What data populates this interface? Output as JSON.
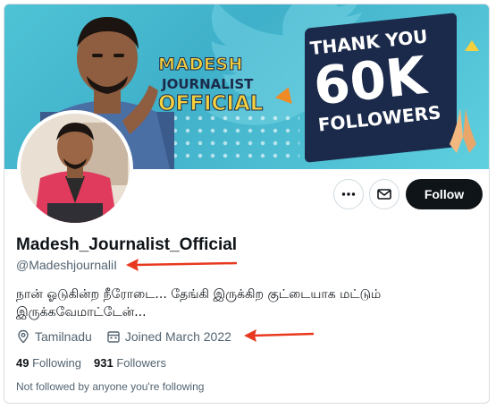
{
  "banner": {
    "title_line1": "MADESH",
    "title_line2": "JOURNALIST",
    "title_line3": "OFFICIAL",
    "thanks_line1": "THANK YOU",
    "thanks_line2": "60K",
    "thanks_line3": "FOLLOWERS"
  },
  "profile": {
    "display_name": "Madesh_Journalist_Official",
    "handle": "@MadeshjournaliI",
    "bio": "நான் ஓடுகின்ற நீரோடை... தேங்கி இருக்கிற குட்டையாக மட்டும் இருக்கவேமாட்டேன்...",
    "location": "Tamilnadu",
    "joined": "Joined March 2022",
    "following_count": "49",
    "following_label": "Following",
    "followers_count": "931",
    "followers_label": "Followers",
    "not_followed_text": "Not followed by anyone you're following"
  },
  "actions": {
    "more_icon": "more-horizontal-icon",
    "message_icon": "envelope-icon",
    "follow_label": "Follow"
  },
  "colors": {
    "primary_text": "#0f1419",
    "secondary_text": "#536471",
    "follow_bg": "#0f1419",
    "annotation_arrow": "#e8391f",
    "banner_bg": "#4fc3d6"
  }
}
